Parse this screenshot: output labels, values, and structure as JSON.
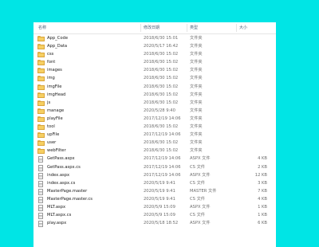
{
  "header": {
    "name": "名称",
    "date": "修改日期",
    "type": "类型",
    "size": "大小"
  },
  "files": [
    {
      "name": "App_Code",
      "date": "2018/6/30 15:01",
      "type": "文件夹",
      "size": "",
      "icon": "folder-icon"
    },
    {
      "name": "App_Data",
      "date": "2020/5/17 16:42",
      "type": "文件夹",
      "size": "",
      "icon": "folder-icon"
    },
    {
      "name": "css",
      "date": "2018/6/30 15:02",
      "type": "文件夹",
      "size": "",
      "icon": "folder-icon"
    },
    {
      "name": "font",
      "date": "2018/6/30 15:02",
      "type": "文件夹",
      "size": "",
      "icon": "folder-icon"
    },
    {
      "name": "images",
      "date": "2018/6/30 15:02",
      "type": "文件夹",
      "size": "",
      "icon": "folder-icon"
    },
    {
      "name": "img",
      "date": "2018/6/30 15:02",
      "type": "文件夹",
      "size": "",
      "icon": "folder-icon"
    },
    {
      "name": "imgFile",
      "date": "2018/6/30 15:02",
      "type": "文件夹",
      "size": "",
      "icon": "folder-icon"
    },
    {
      "name": "imgHead",
      "date": "2018/6/30 15:02",
      "type": "文件夹",
      "size": "",
      "icon": "folder-icon"
    },
    {
      "name": "js",
      "date": "2018/6/30 15:02",
      "type": "文件夹",
      "size": "",
      "icon": "folder-icon"
    },
    {
      "name": "manage",
      "date": "2020/5/28 9:40",
      "type": "文件夹",
      "size": "",
      "icon": "folder-icon"
    },
    {
      "name": "playFile",
      "date": "2017/12/19 14:06",
      "type": "文件夹",
      "size": "",
      "icon": "folder-icon"
    },
    {
      "name": "tool",
      "date": "2018/6/30 15:02",
      "type": "文件夹",
      "size": "",
      "icon": "folder-icon"
    },
    {
      "name": "upFile",
      "date": "2017/12/19 14:06",
      "type": "文件夹",
      "size": "",
      "icon": "folder-icon"
    },
    {
      "name": "user",
      "date": "2018/6/30 15:02",
      "type": "文件夹",
      "size": "",
      "icon": "folder-icon"
    },
    {
      "name": "webFilter",
      "date": "2018/6/30 15:02",
      "type": "文件夹",
      "size": "",
      "icon": "folder-icon"
    },
    {
      "name": "GetPass.aspx",
      "date": "2017/12/19 14:06",
      "type": "ASPX 文件",
      "size": "4 KB",
      "icon": "file-icon"
    },
    {
      "name": "GetPass.aspx.cs",
      "date": "2017/12/19 14:06",
      "type": "CS 文件",
      "size": "2 KB",
      "icon": "file-icon"
    },
    {
      "name": "index.aspx",
      "date": "2017/12/19 14:06",
      "type": "ASPX 文件",
      "size": "12 KB",
      "icon": "file-icon"
    },
    {
      "name": "index.aspx.cs",
      "date": "2020/5/19 9:41",
      "type": "CS 文件",
      "size": "3 KB",
      "icon": "file-icon"
    },
    {
      "name": "MasterPage.master",
      "date": "2020/5/19 9:41",
      "type": "MASTER 文件",
      "size": "7 KB",
      "icon": "file-icon"
    },
    {
      "name": "MasterPage.master.cs",
      "date": "2020/5/19 9:41",
      "type": "CS 文件",
      "size": "4 KB",
      "icon": "file-icon"
    },
    {
      "name": "MLT.aspx",
      "date": "2020/5/9 15:09",
      "type": "ASPX 文件",
      "size": "1 KB",
      "icon": "file-icon"
    },
    {
      "name": "MLT.aspx.cs",
      "date": "2020/5/9 15:09",
      "type": "CS 文件",
      "size": "1 KB",
      "icon": "file-icon"
    },
    {
      "name": "play.aspx",
      "date": "2020/5/18 18:52",
      "type": "ASPX 文件",
      "size": "6 KB",
      "icon": "file-icon"
    }
  ]
}
